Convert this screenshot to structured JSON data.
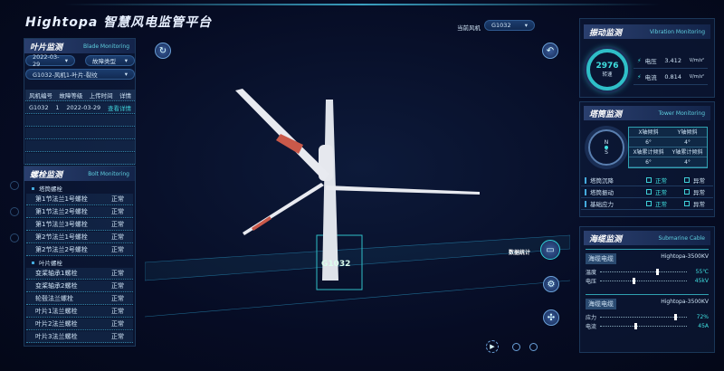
{
  "header": {
    "title": "Hightopa 智慧风电监管平台",
    "current_turbine_label": "当前风机",
    "current_turbine": "G1032"
  },
  "blade": {
    "title": "叶片监测",
    "subtitle": "Blade Monitoring",
    "date": "2022-03-29",
    "fault_type": "故障类型",
    "fault_select": "G1032-风机1-叶片-裂纹",
    "headers": [
      "风机编号",
      "故障等级",
      "上传时间",
      "详情"
    ],
    "rows": [
      {
        "id": "G1032",
        "level": "1",
        "time": "2022-03-29",
        "detail": "查看详情"
      }
    ]
  },
  "bolt": {
    "title": "螺栓监测",
    "subtitle": "Bolt Monitoring",
    "groups": [
      {
        "name": "塔筒螺栓",
        "items": [
          {
            "name": "第1节法兰1号螺栓",
            "status": "正常"
          },
          {
            "name": "第1节法兰2号螺栓",
            "status": "正常"
          },
          {
            "name": "第1节法兰3号螺栓",
            "status": "正常"
          },
          {
            "name": "第2节法兰1号螺栓",
            "status": "正常"
          },
          {
            "name": "第2节法兰2号螺栓",
            "status": "正常"
          }
        ]
      },
      {
        "name": "叶片螺栓",
        "items": [
          {
            "name": "变桨轴承1螺栓",
            "status": "正常"
          },
          {
            "name": "变桨轴承2螺栓",
            "status": "正常"
          },
          {
            "name": "轮毂法兰螺栓",
            "status": "正常"
          },
          {
            "name": "叶片1法兰螺栓",
            "status": "正常"
          },
          {
            "name": "叶片2法兰螺栓",
            "status": "正常"
          },
          {
            "name": "叶片3法兰螺栓",
            "status": "正常"
          }
        ]
      }
    ]
  },
  "vibration": {
    "title": "振动监测",
    "subtitle": "Vibration Monitoring",
    "gauge_value": "2976",
    "gauge_label": "转速",
    "readings": [
      {
        "label": "电压",
        "value": "3.412",
        "unit": "V/m/s²"
      },
      {
        "label": "电流",
        "value": "0.814",
        "unit": "V/m/s²"
      }
    ]
  },
  "tower": {
    "title": "塔筒监测",
    "subtitle": "Tower Monitoring",
    "table": [
      [
        "X轴倾斜",
        "Y轴倾斜"
      ],
      [
        "6°",
        "4°"
      ],
      [
        "X轴累计倾斜",
        "Y轴累计倾斜"
      ],
      [
        "6°",
        "4°"
      ]
    ],
    "compass": [
      "N",
      "E",
      "S",
      "W"
    ],
    "status": [
      {
        "name": "塔筒沉降",
        "a": "正常",
        "b": "异常"
      },
      {
        "name": "塔筒振动",
        "a": "正常",
        "b": "异常"
      },
      {
        "name": "基础应力",
        "a": "正常",
        "b": "异常"
      }
    ]
  },
  "cable": {
    "title": "海缆监测",
    "subtitle": "Submarine Cable",
    "blocks": [
      {
        "name": "海缆电缆",
        "model": "Hightopa-3500KV",
        "rows": [
          {
            "label": "温度",
            "value": "55℃",
            "level": 0.65
          },
          {
            "label": "电压",
            "value": "45kV",
            "level": 0.37
          }
        ]
      },
      {
        "name": "海缆电缆",
        "model": "Hightopa-3500KV",
        "rows": [
          {
            "label": "应力",
            "value": "72%",
            "level": 0.85
          },
          {
            "label": "电流",
            "value": "45A",
            "level": 0.4
          }
        ]
      }
    ]
  },
  "center": {
    "stats_button": "数据统计",
    "turbine_tag": "G1032"
  }
}
